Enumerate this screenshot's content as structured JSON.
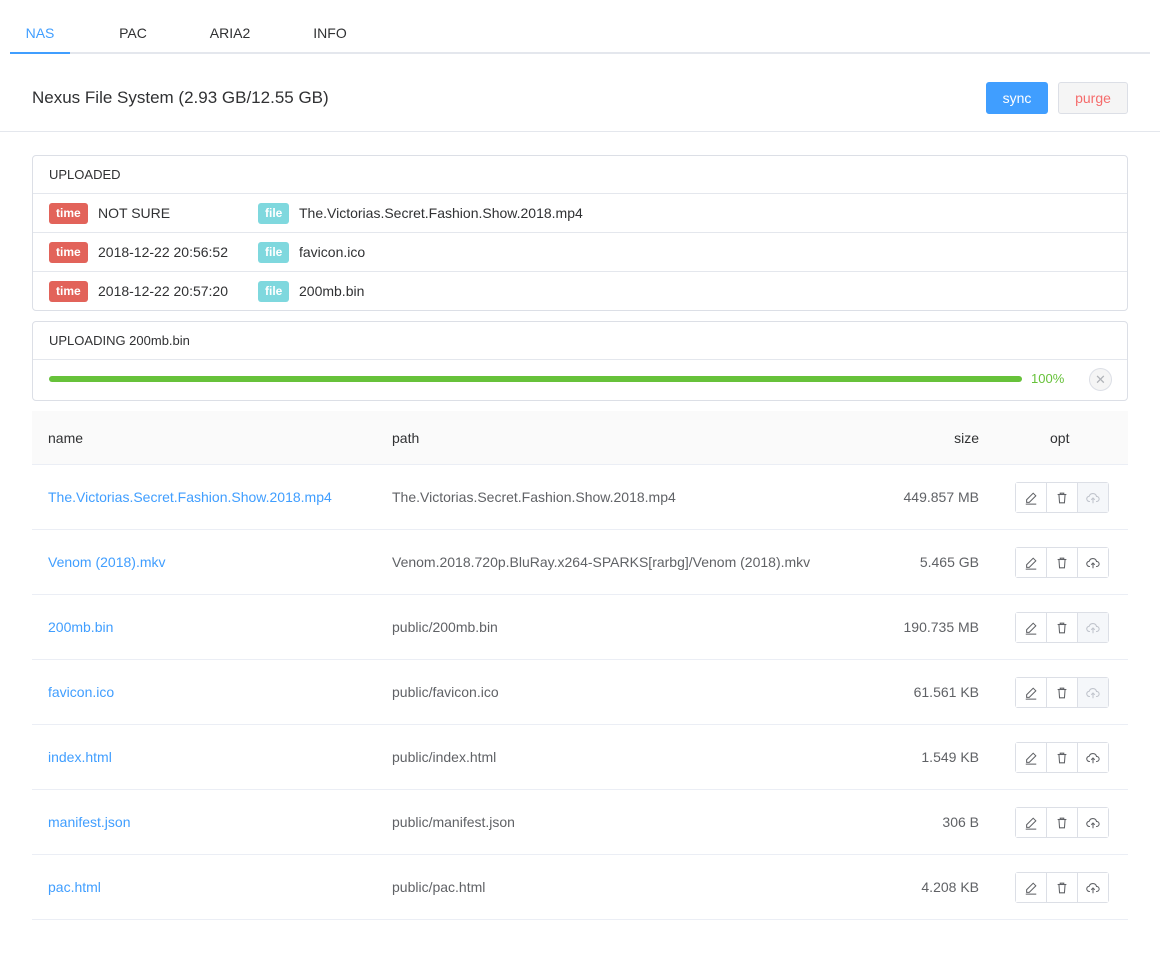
{
  "tabs": [
    {
      "label": "NAS",
      "active": true
    },
    {
      "label": "PAC",
      "active": false
    },
    {
      "label": "ARIA2",
      "active": false
    },
    {
      "label": "INFO",
      "active": false
    }
  ],
  "header": {
    "title": "Nexus File System (2.93 GB/12.55 GB)",
    "sync_label": "sync",
    "purge_label": "purge"
  },
  "uploaded": {
    "title": "UPLOADED",
    "time_tag": "time",
    "file_tag": "file",
    "rows": [
      {
        "time": "NOT SURE",
        "file": "The.Victorias.Secret.Fashion.Show.2018.mp4"
      },
      {
        "time": "2018-12-22 20:56:52",
        "file": "favicon.ico"
      },
      {
        "time": "2018-12-22 20:57:20",
        "file": "200mb.bin"
      }
    ]
  },
  "uploading": {
    "title": "UPLOADING 200mb.bin",
    "percent": 100,
    "percent_text": "100%"
  },
  "table": {
    "headers": {
      "name": "name",
      "path": "path",
      "size": "size",
      "opt": "opt"
    },
    "rows": [
      {
        "name": "The.Victorias.Secret.Fashion.Show.2018.mp4",
        "path": "The.Victorias.Secret.Fashion.Show.2018.mp4",
        "size": "449.857 MB",
        "upload_enabled": false
      },
      {
        "name": "Venom (2018).mkv",
        "path": "Venom.2018.720p.BluRay.x264-SPARKS[rarbg]/Venom (2018).mkv",
        "size": "5.465 GB",
        "upload_enabled": true
      },
      {
        "name": "200mb.bin",
        "path": "public/200mb.bin",
        "size": "190.735 MB",
        "upload_enabled": false
      },
      {
        "name": "favicon.ico",
        "path": "public/favicon.ico",
        "size": "61.561 KB",
        "upload_enabled": false
      },
      {
        "name": "index.html",
        "path": "public/index.html",
        "size": "1.549 KB",
        "upload_enabled": true
      },
      {
        "name": "manifest.json",
        "path": "public/manifest.json",
        "size": "306 B",
        "upload_enabled": true
      },
      {
        "name": "pac.html",
        "path": "public/pac.html",
        "size": "4.208 KB",
        "upload_enabled": true
      }
    ],
    "op_icons": [
      "edit-icon",
      "delete-icon",
      "cloud-upload-icon"
    ]
  },
  "colors": {
    "primary": "#409eff",
    "danger": "#f56c6c",
    "success": "#67c23a",
    "time_tag": "#e2635a",
    "file_tag": "#7fd8de"
  }
}
